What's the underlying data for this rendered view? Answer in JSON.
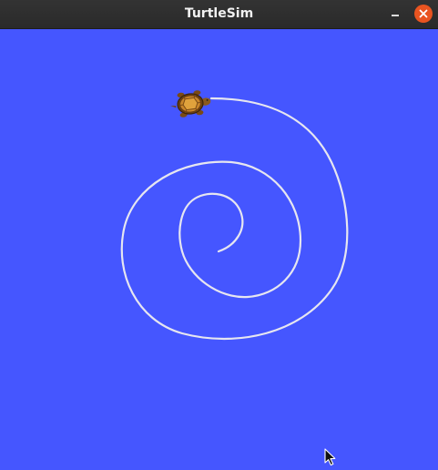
{
  "window": {
    "title": "TurtleSim"
  },
  "titlebar_buttons": {
    "minimize_icon": "minimize-icon",
    "close_icon": "close-icon"
  },
  "colors": {
    "background": "#4556ff",
    "pen": "#e6e6f0",
    "titlebar": "#2f2f2f",
    "close_button": "#e95420"
  },
  "icons": {
    "turtle": "turtle-icon",
    "cursor": "mouse-cursor-icon"
  }
}
